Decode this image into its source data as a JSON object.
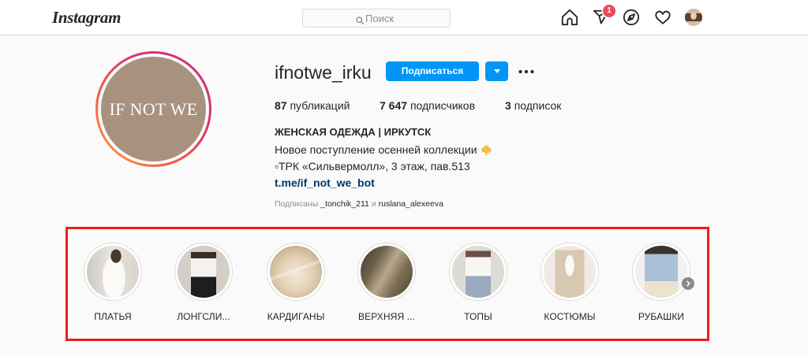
{
  "colors": {
    "accent": "#0095f6",
    "link": "#00376b",
    "badge": "#ed4956",
    "annotation_box": "#ee1b1b"
  },
  "nav": {
    "logo": "Instagram",
    "search_placeholder": "Поиск",
    "direct_badge": "1",
    "icons": {
      "search": "search-icon",
      "home": "home-icon",
      "direct": "direct-icon",
      "explore": "compass-icon",
      "activity": "heart-icon",
      "profile": "profile-avatar-icon"
    }
  },
  "profile": {
    "avatar_logo": "IF NOT WE",
    "username": "ifnotwe_irku",
    "follow_button": "Подписаться",
    "dropdown_icon": "chevron-down-icon",
    "more_icon": "more-options-icon",
    "stats": [
      {
        "count": "87",
        "label": "публикаций"
      },
      {
        "count": "7 647",
        "label": "подписчиков"
      },
      {
        "count": "3",
        "label": "подписок"
      }
    ],
    "full_name": "ЖЕНСКАЯ ОДЕЖДА | ИРКУТСК",
    "bio_lines": [
      "Новое поступление осенней коллекции",
      "▫ТРК «Сильвермолл», 3 этаж, пав.513"
    ],
    "bio_emoji": "maple-leaf-icon",
    "link": "t.me/if_not_we_bot",
    "followed_by": {
      "prefix": "Подписаны",
      "users": [
        "_tonchik_211",
        "ruslana_alexeeva"
      ],
      "conjunction": "и"
    }
  },
  "highlights": [
    {
      "label": "ПЛАТЬЯ"
    },
    {
      "label": "ЛОНГСЛИ..."
    },
    {
      "label": "КАРДИГАНЫ"
    },
    {
      "label": "ВЕРХНЯЯ ..."
    },
    {
      "label": "ТОПЫ"
    },
    {
      "label": "КОСТЮМЫ"
    },
    {
      "label": "РУБАШКИ"
    }
  ],
  "highlights_next_icon": "chevron-right-icon"
}
